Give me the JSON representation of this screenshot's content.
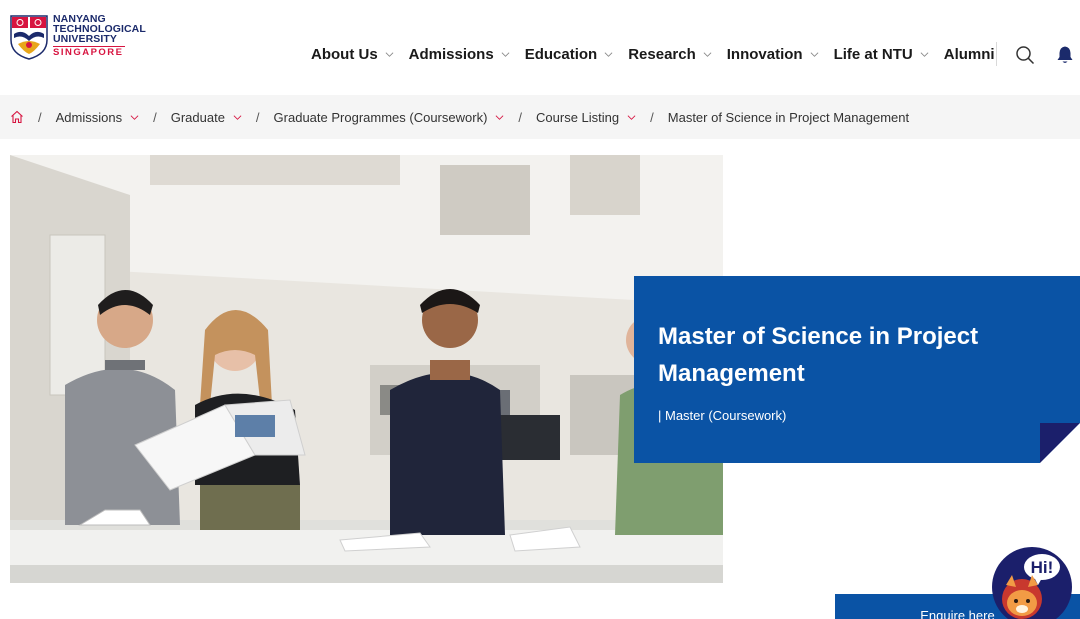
{
  "logo": {
    "line1": "NANYANG",
    "line2": "TECHNOLOGICAL",
    "line3": "UNIVERSITY",
    "line4": "SINGAPORE"
  },
  "nav": {
    "items": [
      {
        "label": "About Us",
        "has_dropdown": true
      },
      {
        "label": "Admissions",
        "has_dropdown": true
      },
      {
        "label": "Education",
        "has_dropdown": true
      },
      {
        "label": "Research",
        "has_dropdown": true
      },
      {
        "label": "Innovation",
        "has_dropdown": true
      },
      {
        "label": "Life at NTU",
        "has_dropdown": true
      },
      {
        "label": "Alumni",
        "has_dropdown": false
      }
    ],
    "icons": [
      "search-icon",
      "bell-icon"
    ]
  },
  "breadcrumb": {
    "separator": "/",
    "items": [
      {
        "label": "Admissions"
      },
      {
        "label": "Graduate"
      },
      {
        "label": "Graduate Programmes (Coursework)"
      },
      {
        "label": "Course Listing"
      }
    ],
    "current": "Master of Science in Project Management"
  },
  "hero": {
    "title_line1": "Master of Science in Project",
    "title_line2": "Management",
    "subtitle": "| Master (Coursework)"
  },
  "enquire": {
    "label": "Enquire here"
  },
  "chatbot": {
    "label": "Hi!"
  },
  "colors": {
    "brand_blue": "#0a53a5",
    "navy": "#1b2a6b",
    "ntu_red": "#d71440"
  }
}
